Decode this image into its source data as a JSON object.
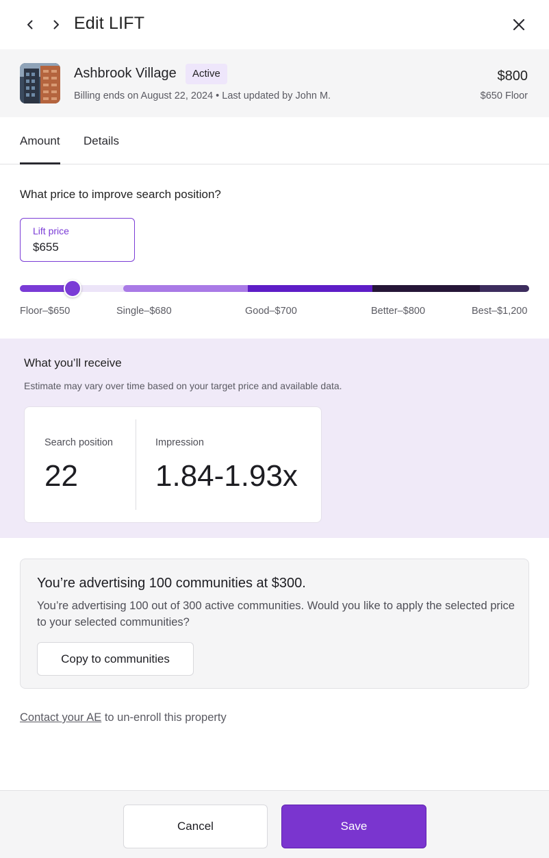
{
  "header": {
    "title": "Edit LIFT",
    "back_icon": "chevron-left-icon",
    "forward_icon": "chevron-right-icon",
    "close_icon": "close-icon"
  },
  "property": {
    "name": "Ashbrook Village",
    "status": "Active",
    "meta": "Billing ends on August 22, 2024 • Last updated by John M.",
    "price": "$800",
    "floor": "$650 Floor"
  },
  "tabs": [
    {
      "label": "Amount",
      "active": true
    },
    {
      "label": "Details",
      "active": false
    }
  ],
  "pricing": {
    "question": "What price to improve search position?",
    "lift_label": "Lift price",
    "lift_value": "$655",
    "slider_value": 655,
    "tiers": [
      {
        "label": "Floor–$650",
        "value": 650
      },
      {
        "label": "Single–$680",
        "value": 680
      },
      {
        "label": "Good–$700",
        "value": 700
      },
      {
        "label": "Better–$800",
        "value": 800
      },
      {
        "label": "Best–$1,200",
        "value": 1200
      }
    ],
    "colors": {
      "accent": "#7a3bd6",
      "track": "#ece4f8",
      "single": "#a97ae6",
      "good": "#5e1dc7",
      "better": "#261638",
      "best": "#3d2d5e"
    }
  },
  "receive": {
    "title": "What you’ll receive",
    "note": "Estimate may vary over time based on your target price and available data.",
    "search_label": "Search position",
    "search_value": "22",
    "impression_label": "Impression",
    "impression_value": "1.84-1.93x"
  },
  "advertising": {
    "title": "You’re advertising 100 communities at $300.",
    "text": "You’re advertising 100 out of 300 active communities. Would you like to apply the selected price to your selected communities?",
    "button": "Copy to communities"
  },
  "contact": {
    "link": "Contact your AE",
    "rest": " to un-enroll this property"
  },
  "footer": {
    "cancel": "Cancel",
    "save": "Save"
  }
}
